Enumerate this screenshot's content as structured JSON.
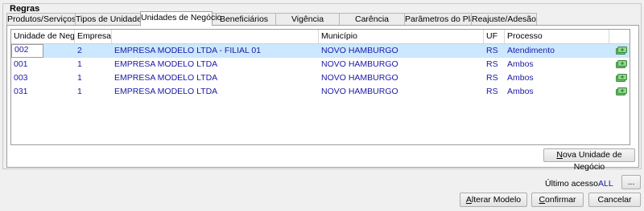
{
  "group": {
    "title": "Regras"
  },
  "tabs": [
    {
      "label": "Produtos/Serviços",
      "width": 86
    },
    {
      "label": "Tipos de Unidades",
      "width": 82
    },
    {
      "label": "Unidades de Negócio",
      "width": 90
    },
    {
      "label": "Beneficiários",
      "width": 80
    },
    {
      "label": "Vigência",
      "width": 80
    },
    {
      "label": "Carência",
      "width": 82
    },
    {
      "label": "Parâmetros do Plano",
      "width": 84
    },
    {
      "label": "Reajuste/Adesão",
      "width": 82
    }
  ],
  "table": {
    "columns": [
      "Unidade de Negócio",
      "Empresa",
      "",
      "Município",
      "UF",
      "Processo"
    ],
    "rows": [
      {
        "unidade": "002",
        "empresa": "2",
        "nome": "EMPRESA MODELO LTDA - FILIAL 01",
        "municipio": "NOVO HAMBURGO",
        "uf": "RS",
        "processo": "Atendimento"
      },
      {
        "unidade": "001",
        "empresa": "1",
        "nome": "EMPRESA MODELO LTDA",
        "municipio": "NOVO HAMBURGO",
        "uf": "RS",
        "processo": "Ambos"
      },
      {
        "unidade": "003",
        "empresa": "1",
        "nome": "EMPRESA MODELO LTDA",
        "municipio": "NOVO HAMBURGO",
        "uf": "RS",
        "processo": "Ambos"
      },
      {
        "unidade": "031",
        "empresa": "1",
        "nome": "EMPRESA MODELO LTDA",
        "municipio": "NOVO HAMBURGO",
        "uf": "RS",
        "processo": "Ambos"
      }
    ],
    "row_icon": "money-icon"
  },
  "buttons": {
    "nova_unidade": {
      "first": "N",
      "rest": "ova Unidade de Negócio"
    },
    "alterar_modelo": {
      "first": "A",
      "rest": "lterar Modelo"
    },
    "confirmar": {
      "first": "C",
      "rest": "onfirmar"
    },
    "cancelar": {
      "first": "",
      "rest": "Cancelar"
    },
    "ellipsis": "..."
  },
  "footer": {
    "ultimo_acesso_label": "Último acesso",
    "ultimo_acesso_value": "ALL"
  },
  "colors": {
    "selection": "#cce8ff",
    "text_blue": "#1a1aa6",
    "icon_green": "#5bb85b"
  }
}
